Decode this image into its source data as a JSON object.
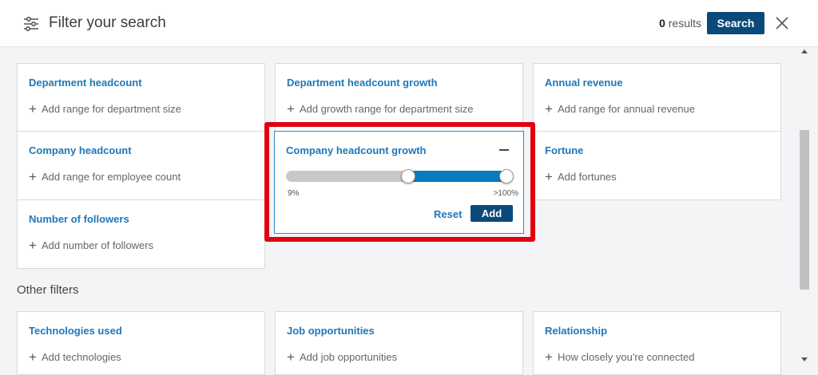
{
  "header": {
    "title": "Filter your search",
    "results_count": "0",
    "results_label": "results",
    "search_label": "Search"
  },
  "cards": {
    "dept_headcount": {
      "title": "Department headcount",
      "add": "Add range for department size"
    },
    "dept_growth": {
      "title": "Department headcount growth",
      "add": "Add growth range for department size"
    },
    "annual_revenue": {
      "title": "Annual revenue",
      "add": "Add range for annual revenue"
    },
    "company_headcount": {
      "title": "Company headcount",
      "add": "Add range for employee count"
    },
    "company_growth": {
      "title": "Company headcount growth",
      "slider_min_label": "9%",
      "slider_max_label": ">100%",
      "slider_low_fraction": 0.54,
      "slider_high_fraction": 1.0,
      "reset_label": "Reset",
      "add_label": "Add"
    },
    "fortune": {
      "title": "Fortune",
      "add": "Add fortunes"
    },
    "followers": {
      "title": "Number of followers",
      "add": "Add number of followers"
    }
  },
  "other_filters": {
    "label": "Other filters",
    "technologies": {
      "title": "Technologies used",
      "add": "Add technologies"
    },
    "jobs": {
      "title": "Job opportunities",
      "add": "Add job opportunities"
    },
    "relationship": {
      "title": "Relationship",
      "add": "How closely you're connected"
    }
  },
  "colors": {
    "link_blue": "#2077b8",
    "primary_button": "#0a4a7a",
    "slider_fill": "#0a7bbd",
    "highlight_red": "#e00010"
  }
}
